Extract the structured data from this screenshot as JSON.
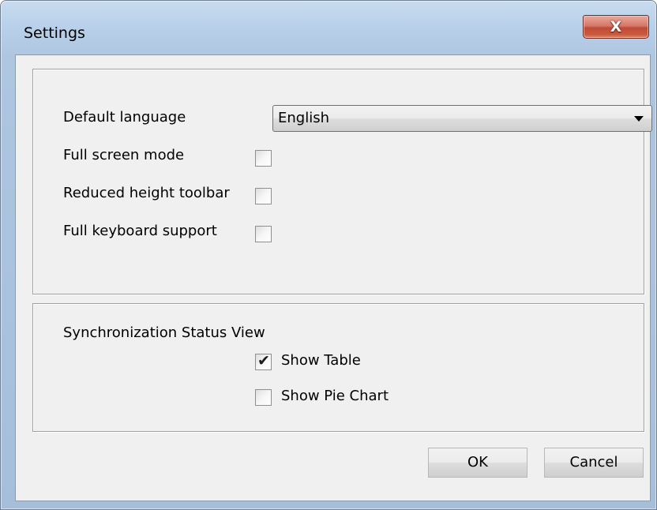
{
  "window": {
    "title": "Settings",
    "close_glyph": "X"
  },
  "general": {
    "default_language_label": "Default language",
    "default_language_value": "English",
    "full_screen_label": "Full screen mode",
    "full_screen_checked": false,
    "reduced_toolbar_label": "Reduced height toolbar",
    "reduced_toolbar_checked": false,
    "keyboard_support_label": "Full keyboard support",
    "keyboard_support_checked": false
  },
  "sync_status": {
    "heading": "Synchronization Status View",
    "show_table_label": "Show Table",
    "show_table_checked": true,
    "show_pie_label": "Show Pie Chart",
    "show_pie_checked": false,
    "check_glyph": "✔"
  },
  "buttons": {
    "ok_label": "OK",
    "cancel_label": "Cancel"
  },
  "icons": {
    "close": "close-icon",
    "dropdown": "chevron-down-icon",
    "check": "checkmark-icon"
  }
}
